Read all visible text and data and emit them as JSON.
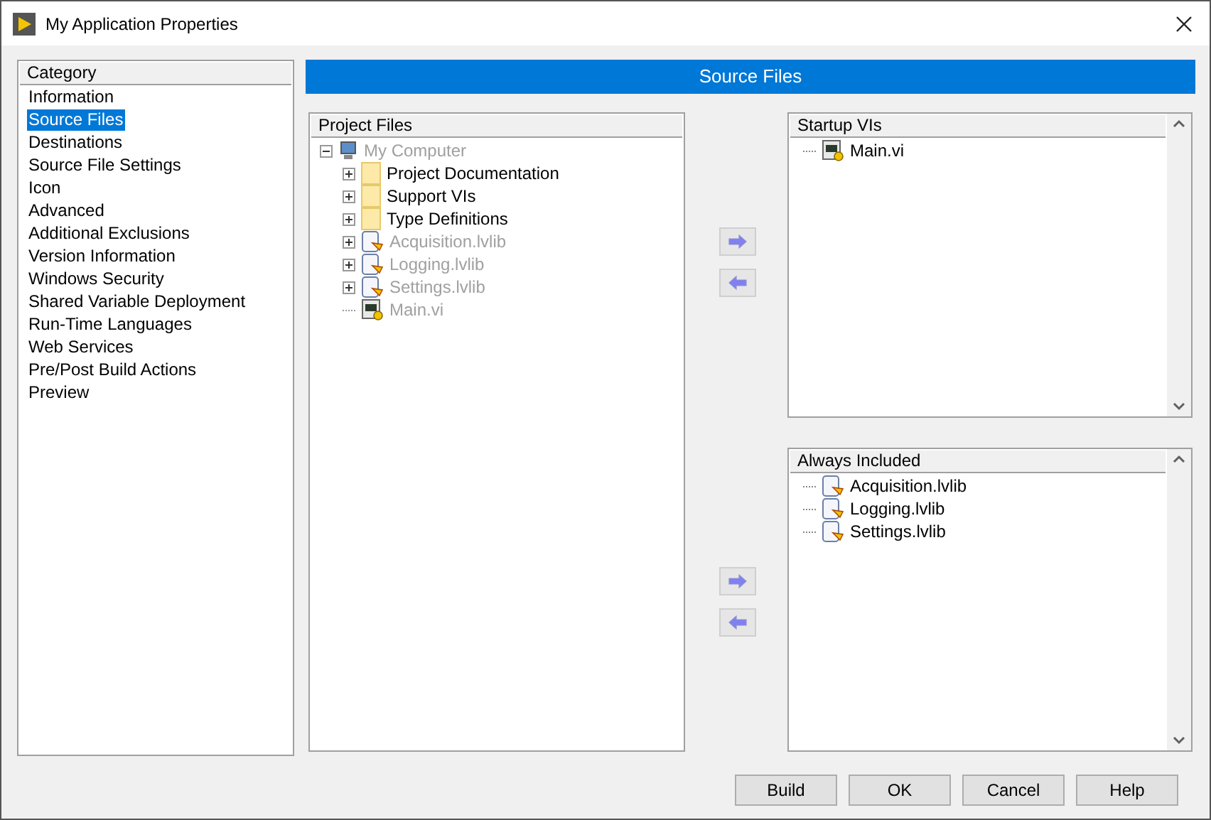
{
  "window": {
    "title": "My Application Properties"
  },
  "category": {
    "header": "Category",
    "items": [
      {
        "label": "Information",
        "selected": false
      },
      {
        "label": "Source Files",
        "selected": true
      },
      {
        "label": "Destinations",
        "selected": false
      },
      {
        "label": "Source File Settings",
        "selected": false
      },
      {
        "label": "Icon",
        "selected": false
      },
      {
        "label": "Advanced",
        "selected": false
      },
      {
        "label": "Additional Exclusions",
        "selected": false
      },
      {
        "label": "Version Information",
        "selected": false
      },
      {
        "label": "Windows Security",
        "selected": false
      },
      {
        "label": "Shared Variable Deployment",
        "selected": false
      },
      {
        "label": "Run-Time Languages",
        "selected": false
      },
      {
        "label": "Web Services",
        "selected": false
      },
      {
        "label": "Pre/Post Build Actions",
        "selected": false
      },
      {
        "label": "Preview",
        "selected": false
      }
    ]
  },
  "page_title": "Source Files",
  "project_files": {
    "header": "Project Files",
    "tree": [
      {
        "label": "My Computer",
        "kind": "computer",
        "expanded": true,
        "disabled": true,
        "children": [
          {
            "label": "Project Documentation",
            "kind": "folder",
            "expanded": false,
            "disabled": false
          },
          {
            "label": "Support VIs",
            "kind": "folder",
            "expanded": false,
            "disabled": false
          },
          {
            "label": "Type Definitions",
            "kind": "folder",
            "expanded": false,
            "disabled": false
          },
          {
            "label": "Acquisition.lvlib",
            "kind": "library",
            "expanded": false,
            "disabled": true
          },
          {
            "label": "Logging.lvlib",
            "kind": "library",
            "expanded": false,
            "disabled": true
          },
          {
            "label": "Settings.lvlib",
            "kind": "library",
            "expanded": false,
            "disabled": true
          },
          {
            "label": "Main.vi",
            "kind": "vi",
            "disabled": true
          }
        ]
      }
    ]
  },
  "startup_vis": {
    "header": "Startup VIs",
    "items": [
      {
        "label": "Main.vi",
        "kind": "vi"
      }
    ]
  },
  "always_included": {
    "header": "Always Included",
    "items": [
      {
        "label": "Acquisition.lvlib",
        "kind": "library"
      },
      {
        "label": "Logging.lvlib",
        "kind": "library"
      },
      {
        "label": "Settings.lvlib",
        "kind": "library"
      }
    ]
  },
  "buttons": [
    "Build",
    "OK",
    "Cancel",
    "Help"
  ]
}
